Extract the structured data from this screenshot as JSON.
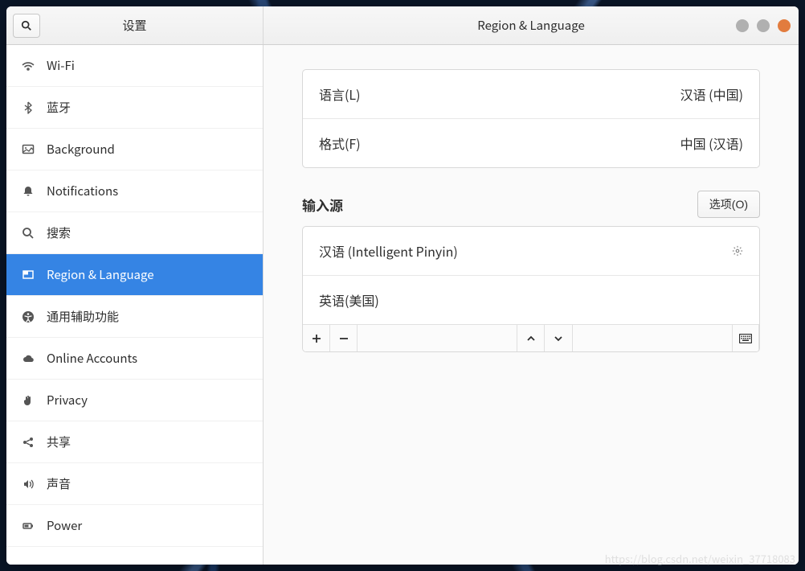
{
  "titlebar": {
    "left_title": "设置",
    "right_title": "Region & Language"
  },
  "sidebar": {
    "items": [
      {
        "icon": "wifi",
        "label": "Wi-Fi"
      },
      {
        "icon": "bluetooth",
        "label": "蓝牙"
      },
      {
        "icon": "background",
        "label": "Background"
      },
      {
        "icon": "bell",
        "label": "Notifications"
      },
      {
        "icon": "search",
        "label": "搜索"
      },
      {
        "icon": "flag",
        "label": "Region & Language"
      },
      {
        "icon": "accessibility",
        "label": "通用辅助功能"
      },
      {
        "icon": "cloud",
        "label": "Online Accounts"
      },
      {
        "icon": "hand",
        "label": "Privacy"
      },
      {
        "icon": "share",
        "label": "共享"
      },
      {
        "icon": "sound",
        "label": "声音"
      },
      {
        "icon": "power",
        "label": "Power"
      }
    ],
    "selected_index": 5
  },
  "region": {
    "language_label": "语言(L)",
    "language_value": "汉语 (中国)",
    "format_label": "格式(F)",
    "format_value": "中国 (汉语)"
  },
  "input_sources": {
    "title": "输入源",
    "options_label": "选项(O)",
    "items": [
      {
        "label": "汉语 (Intelligent Pinyin)",
        "has_gear": true
      },
      {
        "label": "英语(美国)",
        "has_gear": false
      }
    ]
  },
  "watermark": "https://blog.csdn.net/weixin_37718083"
}
